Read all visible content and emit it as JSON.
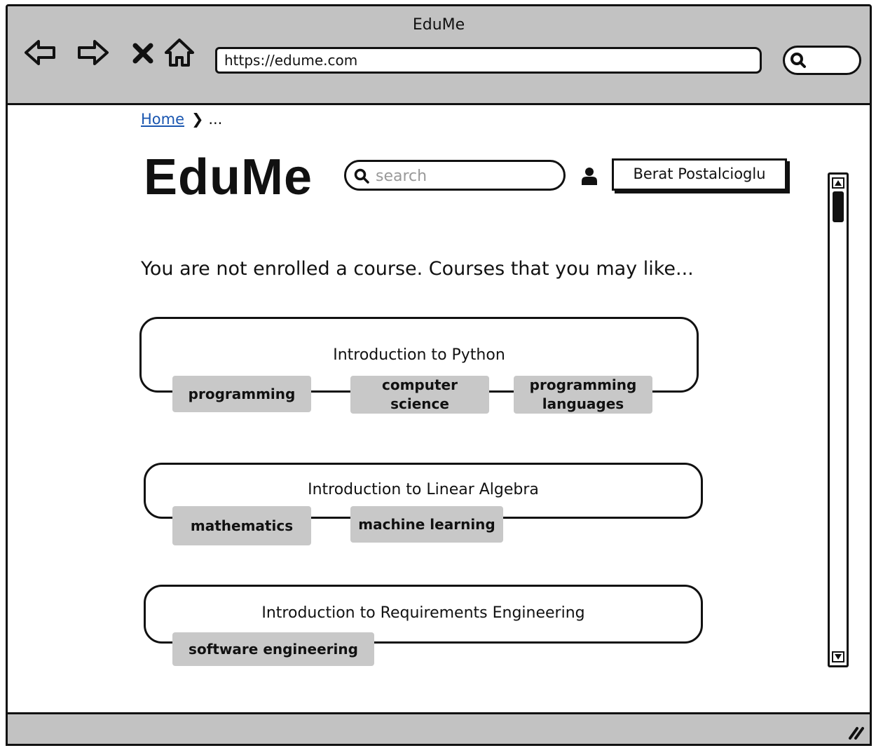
{
  "window": {
    "title": "EduMe"
  },
  "browser": {
    "url": "https://edume.com",
    "icons": [
      "back-arrow-icon",
      "forward-arrow-icon",
      "close-icon",
      "home-icon",
      "search-icon"
    ]
  },
  "breadcrumb": {
    "home": "Home",
    "separator": "❯",
    "current": "..."
  },
  "header": {
    "logo": "EduMe",
    "search_placeholder": "search",
    "user_name": "Berat Postalcioglu"
  },
  "main": {
    "notice": "You are not enrolled a course. Courses that you may like...",
    "courses": [
      {
        "title": "Introduction to Python",
        "tags": [
          "programming",
          "computer science",
          "programming languages"
        ]
      },
      {
        "title": "Introduction to Linear Algebra",
        "tags": [
          "mathematics",
          "machine learning"
        ]
      },
      {
        "title": "Introduction to Requirements Engineering",
        "tags": [
          "software engineering"
        ]
      }
    ]
  },
  "colors": {
    "chrome": "#c2c2c2",
    "tag": "#c8c8c8",
    "link": "#1a56b0",
    "stroke": "#111111"
  }
}
